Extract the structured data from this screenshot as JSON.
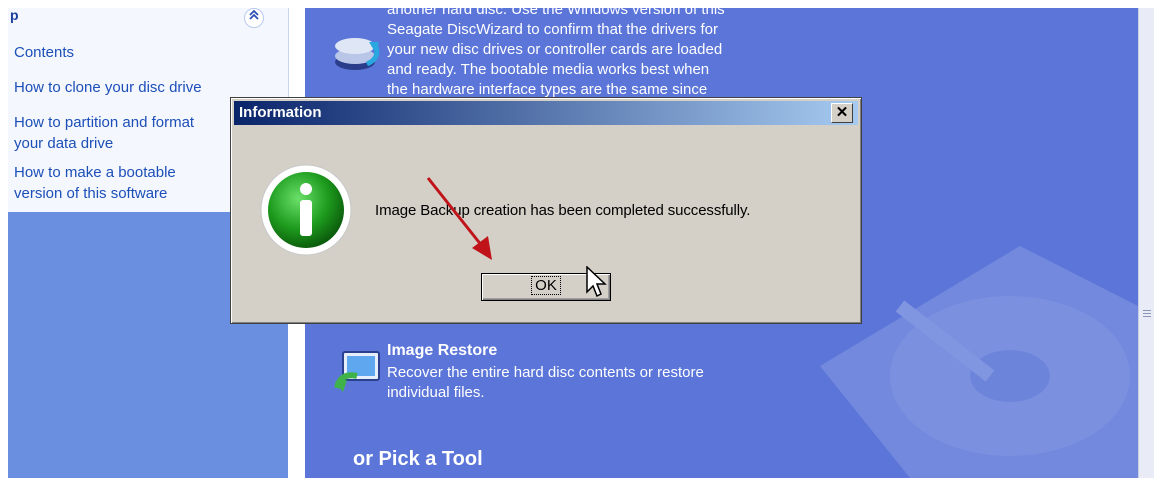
{
  "help_pane": {
    "title": "p",
    "links": [
      "Contents",
      "How to clone your disc drive",
      "How to partition and format",
      "your data drive",
      "How to make a bootable",
      "version of this software"
    ]
  },
  "main": {
    "clone_desc_lines": [
      "another hard disc. Use the Windows version of this",
      "Seagate DiscWizard to confirm that the drivers for",
      "your new disc drives or controller cards are loaded",
      "and ready. The bootable media works best when",
      "the hardware interface types are the same since"
    ],
    "restore_title": "Image Restore",
    "restore_desc_lines": [
      "Recover the entire hard disc contents or restore",
      "individual files."
    ],
    "pick_tool": "or Pick a Tool"
  },
  "dialog": {
    "title": "Information",
    "close_glyph": "✕",
    "message": "Image Backup creation has been completed successfully.",
    "ok_label": "OK"
  },
  "colors": {
    "task_pane": "#6b8fe0",
    "main_bg": "#5b75d8",
    "dialog_bg": "#d4d0c8",
    "titlebar_start": "#0a246a",
    "titlebar_end": "#a6caf0",
    "annotation_arrow": "#c0141a",
    "info_icon": "#1e9c1e"
  },
  "icons": {
    "collapse": "double-chevron-up-icon",
    "info": "information-icon",
    "cursor": "mouse-pointer-icon"
  }
}
